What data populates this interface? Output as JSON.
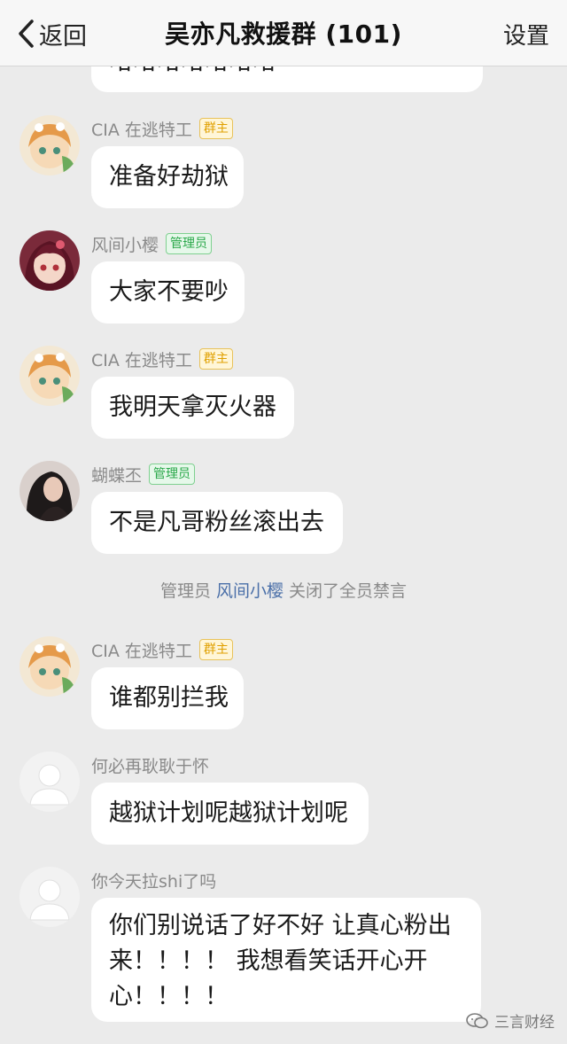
{
  "header": {
    "back_label": "返回",
    "title": "吴亦凡救援群 (101)",
    "settings_label": "设置"
  },
  "roles": {
    "owner": "群主",
    "admin": "管理员"
  },
  "messages": [
    {
      "sender": "",
      "text": "哈哈哈哈哈哈哈"
    },
    {
      "sender": "CIA 在逃特工",
      "role": "群主",
      "text": "准备好劫狱"
    },
    {
      "sender": "风间小樱",
      "role": "管理员",
      "text": "大家不要吵"
    },
    {
      "sender": "CIA 在逃特工",
      "role": "群主",
      "text": "我明天拿灭火器"
    },
    {
      "sender": "蝴蝶丕",
      "role": "管理员",
      "text": "不是凡哥粉丝滚出去"
    },
    {
      "sender": "CIA 在逃特工",
      "role": "群主",
      "text": "谁都别拦我"
    },
    {
      "sender": "何必再耿耿于怀",
      "text": "越狱计划呢越狱计划呢"
    },
    {
      "sender": "你今天拉shi了吗",
      "text_lines": [
        "你们别说话了好不好 让真心粉出",
        "来！！！！ 我想看笑话开心开",
        "心！！！！"
      ]
    }
  ],
  "system_notice": {
    "prefix": "管理员 ",
    "admin_name": "风间小樱",
    "suffix": " 关闭了全员禁言"
  },
  "watermark": {
    "text": "三言财经"
  },
  "colors": {
    "background": "#ebebeb",
    "bubble": "#ffffff",
    "owner_badge": "#e0a000",
    "admin_badge": "#2aa84a",
    "link": "#4a6fa8"
  }
}
